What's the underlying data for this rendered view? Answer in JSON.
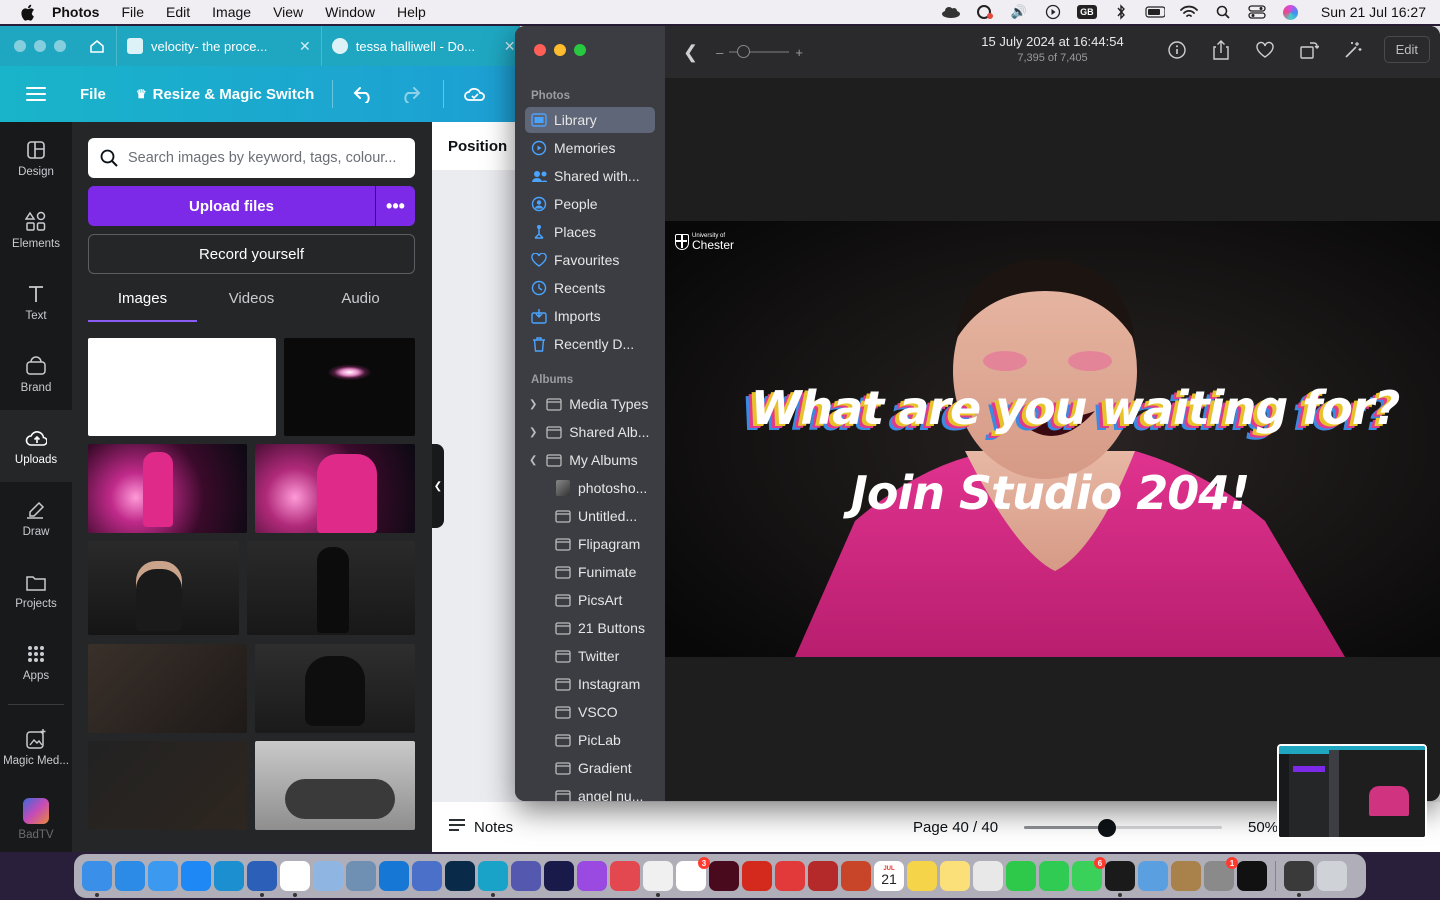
{
  "menubar": {
    "app_name": "Photos",
    "menus": [
      "File",
      "Edit",
      "Image",
      "View",
      "Window",
      "Help"
    ],
    "status_icons": [
      "cloud-icon",
      "creative-cloud-icon",
      "volume-icon",
      "play-icon",
      "keyboard-layout-icon",
      "bluetooth-icon",
      "battery-icon",
      "wifi-icon",
      "search-icon",
      "control-center-icon",
      "siri-icon"
    ],
    "keyboard_layout": "GB",
    "clock": "Sun 21 Jul  16:27"
  },
  "canva": {
    "tabs": [
      {
        "title": "velocity- the proce..."
      },
      {
        "title": "tessa halliwell - Do..."
      }
    ],
    "toolbar": {
      "file_label": "File",
      "resize_label": "Resize & Magic Switch"
    },
    "rail": [
      {
        "label": "Design",
        "icon": "design-icon"
      },
      {
        "label": "Elements",
        "icon": "elements-icon"
      },
      {
        "label": "Text",
        "icon": "text-icon"
      },
      {
        "label": "Brand",
        "icon": "brand-icon"
      },
      {
        "label": "Uploads",
        "icon": "uploads-icon",
        "active": true
      },
      {
        "label": "Draw",
        "icon": "draw-icon"
      },
      {
        "label": "Projects",
        "icon": "projects-icon"
      },
      {
        "label": "Apps",
        "icon": "apps-icon"
      },
      {
        "label": "Magic Med...",
        "icon": "magic-media-icon"
      },
      {
        "label": "BadTV",
        "icon": "badtv-icon"
      }
    ],
    "panel": {
      "search_placeholder": "Search images by keyword, tags, colour...",
      "upload_label": "Upload files",
      "record_label": "Record yourself",
      "media_tabs": [
        "Images",
        "Videos",
        "Audio"
      ],
      "active_media_tab": "Images"
    },
    "position_label": "Position",
    "bottom": {
      "notes_label": "Notes",
      "page_indicator": "Page 40 / 40",
      "zoom_label": "50%",
      "zoom_level": 0.42
    }
  },
  "photos": {
    "sidebar": {
      "photos_heading": "Photos",
      "photos_items": [
        {
          "label": "Library",
          "icon": "library-icon",
          "active": true
        },
        {
          "label": "Memories",
          "icon": "memories-icon"
        },
        {
          "label": "Shared with...",
          "icon": "shared-with-you-icon"
        },
        {
          "label": "People",
          "icon": "people-icon"
        },
        {
          "label": "Places",
          "icon": "places-icon"
        },
        {
          "label": "Favourites",
          "icon": "heart-icon"
        },
        {
          "label": "Recents",
          "icon": "recents-icon"
        },
        {
          "label": "Imports",
          "icon": "imports-icon"
        },
        {
          "label": "Recently D...",
          "icon": "trash-icon"
        }
      ],
      "albums_heading": "Albums",
      "album_groups": [
        {
          "label": "Media Types",
          "expanded": false
        },
        {
          "label": "Shared Alb...",
          "expanded": false
        },
        {
          "label": "My Albums",
          "expanded": true
        }
      ],
      "albums": [
        "photosho...",
        "Untitled...",
        "Flipagram",
        "Funimate",
        "PicsArt",
        "21 Buttons",
        "Twitter",
        "Instagram",
        "VSCO",
        "PicLab",
        "Gradient",
        "angel nu..."
      ]
    },
    "toolbar": {
      "date": "15 July 2024 at 16:44:54",
      "count": "7,395 of 7,405",
      "edit_label": "Edit",
      "tools": [
        "info-icon",
        "share-icon",
        "heart-icon",
        "rotate-icon",
        "magic-wand-icon"
      ]
    },
    "image": {
      "logo_small": "University of",
      "logo_large": "Chester",
      "headline": "What are you waiting for?",
      "subline": "Join Studio 204!"
    }
  },
  "dock": {
    "apps": [
      {
        "name": "Finder",
        "color": "#3a8fe8"
      },
      {
        "name": "Safari",
        "color": "#2b8be6"
      },
      {
        "name": "Mail",
        "color": "#3b9af0"
      },
      {
        "name": "App Store",
        "color": "#1e88f5"
      },
      {
        "name": "Prime Video",
        "color": "#1b8fd0"
      },
      {
        "name": "Word",
        "color": "#2b5fb8"
      },
      {
        "name": "Tweetbot",
        "color": "#ffffff"
      },
      {
        "name": "Preview",
        "color": "#8fb6e3"
      },
      {
        "name": "Preview 2",
        "color": "#6f8fb3"
      },
      {
        "name": "Outlook",
        "color": "#1677d4"
      },
      {
        "name": "Sphere",
        "color": "#4a70c9"
      },
      {
        "name": "Photoshop",
        "color": "#0a2a4a"
      },
      {
        "name": "Canva",
        "color": "#1aa3c8"
      },
      {
        "name": "Teams",
        "color": "#5558af"
      },
      {
        "name": "After Effects",
        "color": "#1a1a4a"
      },
      {
        "name": "Podcasts",
        "color": "#9a4ae0"
      },
      {
        "name": "Creative Cloud",
        "color": "#e34850"
      },
      {
        "name": "Photos",
        "color": "#f0f0f0"
      },
      {
        "name": "Reminders",
        "color": "#ffffff"
      },
      {
        "name": "InDesign",
        "color": "#4a0a1e"
      },
      {
        "name": "Acrobat",
        "color": "#d42a1e"
      },
      {
        "name": "Airmail",
        "color": "#e23a3a"
      },
      {
        "name": "Dictionary",
        "color": "#b42a2a"
      },
      {
        "name": "PowerPoint",
        "color": "#c9452a"
      },
      {
        "name": "Calendar",
        "color": "#ffffff"
      },
      {
        "name": "Stickies",
        "color": "#f5d44a"
      },
      {
        "name": "Notes",
        "color": "#fbe07a"
      },
      {
        "name": "Chrome",
        "color": "#e8e8e8"
      },
      {
        "name": "FaceTime",
        "color": "#2ec84a"
      },
      {
        "name": "WhatsApp",
        "color": "#2fcb52"
      },
      {
        "name": "Messages",
        "color": "#3ad15a"
      },
      {
        "name": "Spotify",
        "color": "#1a1a1a"
      },
      {
        "name": "Maps",
        "color": "#5aa0e0"
      },
      {
        "name": "Archive",
        "color": "#a8824a"
      },
      {
        "name": "System Settings",
        "color": "#8a8a8a"
      },
      {
        "name": "CapCut",
        "color": "#111111"
      },
      {
        "name": "Screenshot",
        "color": "#3a3a3a"
      },
      {
        "name": "Trash",
        "color": "#cfd2d6"
      }
    ],
    "calendar_month": "JUL",
    "calendar_day": "21",
    "badges": {
      "Reminders": "3",
      "Messages": "6",
      "System Settings": "1"
    }
  }
}
